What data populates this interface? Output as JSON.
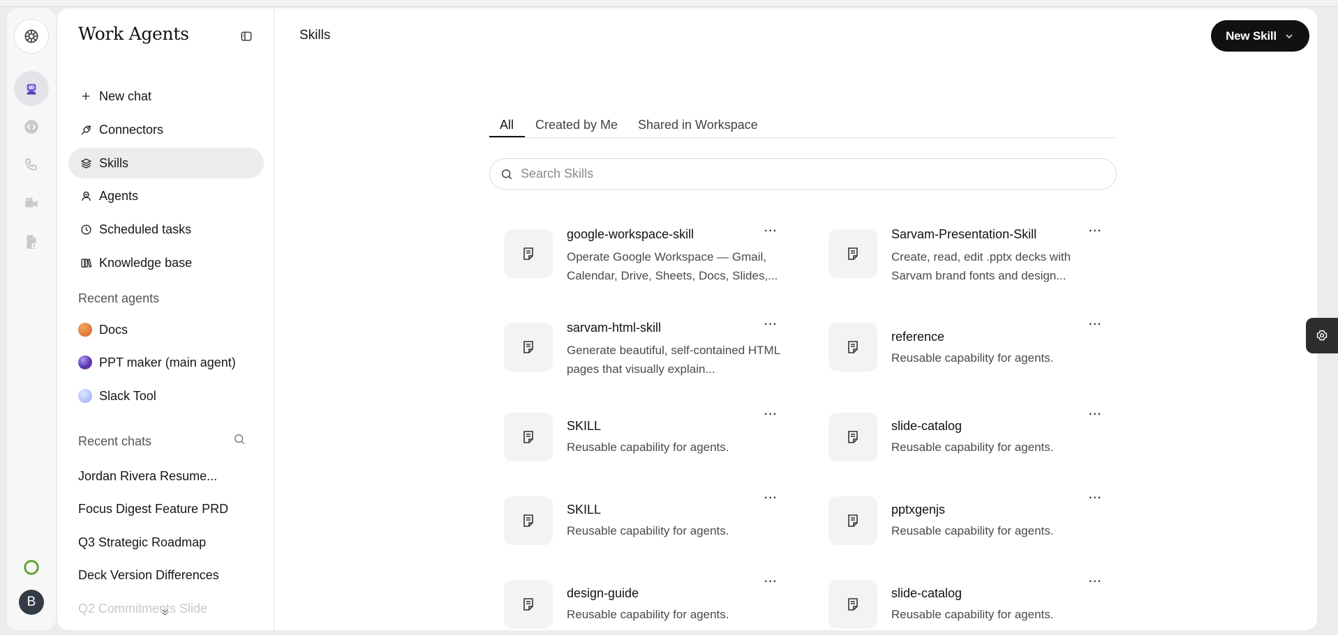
{
  "app": {
    "workspace_title": "Work Agents",
    "avatar_letter": "B"
  },
  "rail": {
    "icons": [
      "openai-logo-icon",
      "agent-robot-icon",
      "code-icon",
      "phone-icon",
      "video-camera-icon",
      "document-icon"
    ]
  },
  "sidebar": {
    "nav": [
      {
        "label": "New chat",
        "icon": "plus-icon"
      },
      {
        "label": "Connectors",
        "icon": "plug-icon"
      },
      {
        "label": "Skills",
        "icon": "layers-icon",
        "active": true
      },
      {
        "label": "Agents",
        "icon": "robot-icon"
      },
      {
        "label": "Scheduled tasks",
        "icon": "clock-icon"
      },
      {
        "label": "Knowledge base",
        "icon": "books-icon"
      }
    ],
    "recent_agents_label": "Recent agents",
    "recent_agents": [
      {
        "label": "Docs",
        "color": "#e0783a"
      },
      {
        "label": "PPT maker (main agent)",
        "color": "#6a4fc4"
      },
      {
        "label": "Slack Tool",
        "color": "#a9b8f5"
      }
    ],
    "recent_chats_label": "Recent chats",
    "recent_chats": [
      "Jordan Rivera Resume...",
      "Focus Digest Feature PRD",
      "Q3 Strategic Roadmap",
      "Deck Version Differences",
      "Q2 Commitments Slide"
    ]
  },
  "header": {
    "title": "Skills",
    "new_skill_label": "New Skill"
  },
  "tabs": [
    "All",
    "Created by Me",
    "Shared in Workspace"
  ],
  "search": {
    "placeholder": "Search Skills",
    "value": ""
  },
  "skills": [
    {
      "name": "google-workspace-skill",
      "description": "Operate Google Workspace — Gmail, Calendar, Drive, Sheets, Docs, Slides,..."
    },
    {
      "name": "Sarvam-Presentation-Skill",
      "description": "Create, read, edit .pptx decks with Sarvam brand fonts and design..."
    },
    {
      "name": "sarvam-html-skill",
      "description": "Generate beautiful, self-contained HTML pages that visually explain..."
    },
    {
      "name": "reference",
      "description": "Reusable capability for agents."
    },
    {
      "name": "SKILL",
      "description": "Reusable capability for agents."
    },
    {
      "name": "slide-catalog",
      "description": "Reusable capability for agents."
    },
    {
      "name": "SKILL",
      "description": "Reusable capability for agents."
    },
    {
      "name": "pptxgenjs",
      "description": "Reusable capability for agents."
    },
    {
      "name": "design-guide",
      "description": "Reusable capability for agents."
    },
    {
      "name": "slide-catalog",
      "description": "Reusable capability for agents."
    }
  ],
  "more_glyph": "···",
  "colors": {
    "accent": "#111111",
    "status_ring": "#5aa12a",
    "avatar_bg": "#333b45"
  }
}
